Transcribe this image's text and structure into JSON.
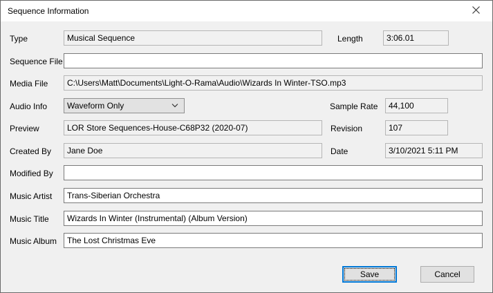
{
  "window": {
    "title": "Sequence Information"
  },
  "fields": {
    "type": {
      "label": "Type",
      "value": "Musical Sequence"
    },
    "length": {
      "label": "Length",
      "value": "3:06.01"
    },
    "sequence_file": {
      "label": "Sequence File",
      "value": ""
    },
    "media_file": {
      "label": "Media File",
      "value": "C:\\Users\\Matt\\Documents\\Light-O-Rama\\Audio\\Wizards In Winter-TSO.mp3"
    },
    "audio_info": {
      "label": "Audio Info",
      "value": "Waveform Only"
    },
    "sample_rate": {
      "label": "Sample Rate",
      "value": "44,100"
    },
    "preview": {
      "label": "Preview",
      "value": "LOR Store Sequences-House-C68P32 (2020-07)"
    },
    "revision": {
      "label": "Revision",
      "value": "107"
    },
    "created_by": {
      "label": "Created By",
      "value": "Jane Doe"
    },
    "date": {
      "label": "Date",
      "value": "3/10/2021 5:11 PM"
    },
    "modified_by": {
      "label": "Modified By",
      "value": ""
    },
    "music_artist": {
      "label": "Music Artist",
      "value": "Trans-Siberian Orchestra"
    },
    "music_title": {
      "label": "Music Title",
      "value": "Wizards In Winter (Instrumental) (Album Version)"
    },
    "music_album": {
      "label": "Music Album",
      "value": "The Lost Christmas Eve"
    }
  },
  "buttons": {
    "save": "Save",
    "cancel": "Cancel"
  },
  "colors": {
    "dialog_background": "#f0f0f0",
    "titlebar_background": "#ffffff",
    "default_button_border": "#0078d7",
    "readonly_field_border": "#b5b5b5",
    "editable_field_border": "#7a7a7a"
  }
}
